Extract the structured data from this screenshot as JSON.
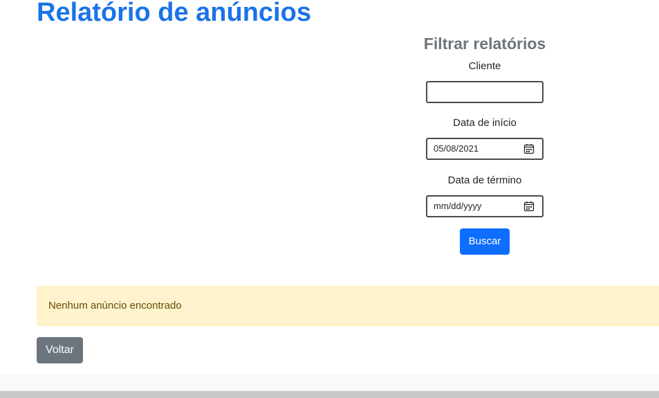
{
  "page": {
    "title": "Relatório de anúncios"
  },
  "filter": {
    "title": "Filtrar relatórios",
    "client_label": "Cliente",
    "client_value": "",
    "start_label": "Data de início",
    "start_value": "05/08/2021",
    "end_label": "Data de término",
    "end_placeholder": "mm/dd/yyyy",
    "search_label": "Buscar"
  },
  "results": {
    "empty_message": "Nenhum anúncio encontrado"
  },
  "actions": {
    "back_label": "Voltar"
  },
  "colors": {
    "title": "#1a73e8",
    "primary_button": "#0d6efd",
    "secondary_button": "#6c757d",
    "alert_background": "#fff3cd",
    "alert_text": "#664d03"
  },
  "icons": {
    "date_picker": "calendar-icon"
  }
}
